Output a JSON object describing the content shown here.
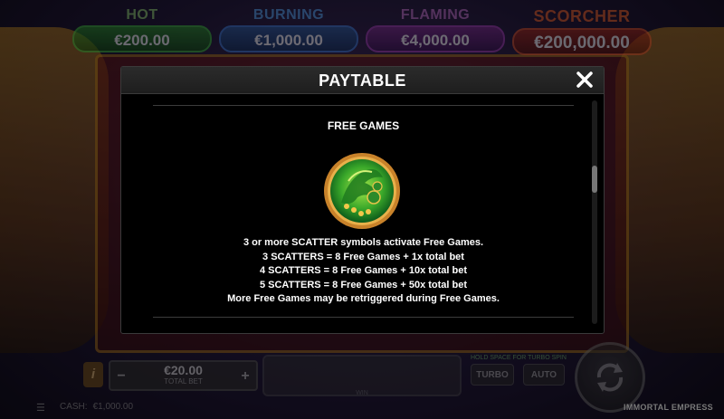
{
  "jackpots": [
    {
      "name": "HOT",
      "value": "€200.00"
    },
    {
      "name": "BURNING",
      "value": "€1,000.00"
    },
    {
      "name": "FLAMING",
      "value": "€4,000.00"
    },
    {
      "name": "SCORCHER",
      "value": "€200,000.00"
    }
  ],
  "modal": {
    "title": "PAYTABLE",
    "section_title": "FREE GAMES",
    "lines": [
      "3 or more SCATTER symbols activate Free Games.",
      "3 SCATTERS = 8 Free Games + 1x total bet",
      "4 SCATTERS = 8 Free Games + 10x total bet",
      "5 SCATTERS = 8 Free Games + 50x total bet",
      "More Free Games may be retriggered during Free Games."
    ],
    "scroll_position": 0.33
  },
  "bottom": {
    "bet_value": "€20.00",
    "bet_label": "TOTAL BET",
    "bet_minus": "−",
    "bet_plus": "+",
    "info_label": "i",
    "win_label": "WIN",
    "hold_text": "HOLD SPACE FOR TURBO SPIN",
    "turbo_label": "TURBO",
    "auto_label": "AUTO",
    "cash_label": "CASH:",
    "cash_value": "€1,000.00",
    "game_name": "IMMORTAL EMPRESS"
  },
  "icons": {
    "close": "close-icon",
    "spin": "spin-arrows-icon",
    "scatter": "green-peacock-scatter-icon"
  }
}
